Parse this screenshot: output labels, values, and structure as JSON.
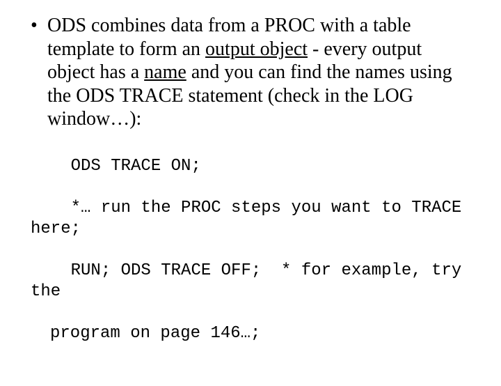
{
  "bullet": {
    "seg1": "ODS combines data from a PROC with a table template to form an ",
    "underlined1": "output object",
    "seg2": " - every output object has a ",
    "underlined2": "name",
    "seg3": " and you can find the names using the ODS TRACE statement (check in the LOG window…):"
  },
  "code": {
    "line1": "ODS TRACE ON;",
    "line2": "*… run the PROC steps you want to TRACE here;",
    "line3a": "RUN; ODS TRACE OFF;  * for example, try the",
    "line3b": "program on page 146…;"
  }
}
